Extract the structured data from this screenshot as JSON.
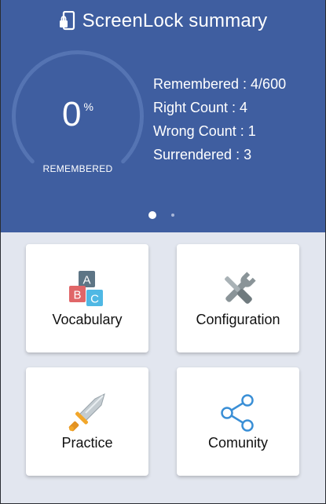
{
  "header": {
    "title": "ScreenLock summary",
    "title_icon": "phone-lock-icon",
    "background_color": "#3f5ea0"
  },
  "gauge": {
    "value": "0",
    "unit": "%",
    "label": "REMEMBERED",
    "fraction": 0.0
  },
  "stats": {
    "remembered": "Remembered : 4/600",
    "right_count": "Right Count : 4",
    "wrong_count": "Wrong Count : 1",
    "surrendered": "Surrendered : 3"
  },
  "pager": {
    "page_count": 2,
    "active_page": 1
  },
  "menu": [
    {
      "label": "Vocabulary",
      "icon": "abc-blocks-icon"
    },
    {
      "label": "Configuration",
      "icon": "wrench-screwdriver-icon"
    },
    {
      "label": "Practice",
      "icon": "sword-icon"
    },
    {
      "label": "Comunity",
      "icon": "share-icon"
    }
  ]
}
